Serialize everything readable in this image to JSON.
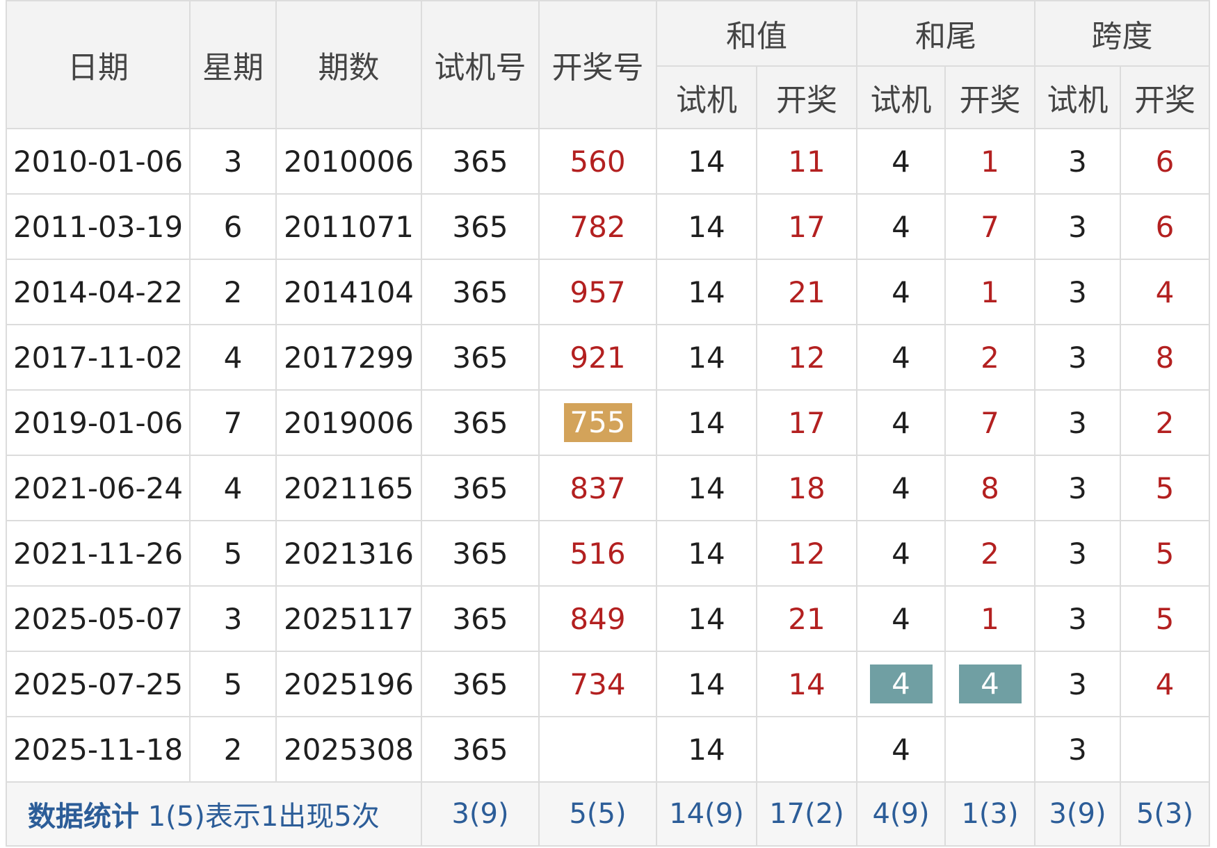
{
  "header": {
    "date": "日期",
    "weekday": "星期",
    "issue": "期数",
    "trial_number": "试机号",
    "draw_number": "开奖号",
    "sum_value": "和值",
    "sum_tail": "和尾",
    "span": "跨度",
    "sub_trial": "试机",
    "sub_draw": "开奖"
  },
  "colors": {
    "draw_text": "#b32020",
    "header_bg": "#f3f3f3",
    "footer_text": "#2c5d98",
    "highlight_gold": "#d3a35a",
    "highlight_teal": "#709fa3"
  },
  "rows": [
    {
      "date": "2010-01-06",
      "weekday": "3",
      "issue": "2010006",
      "trial": "365",
      "draw": "560",
      "sum_trial": "14",
      "sum_draw": "11",
      "tail_trial": "4",
      "tail_draw": "1",
      "span_trial": "3",
      "span_draw": "6"
    },
    {
      "date": "2011-03-19",
      "weekday": "6",
      "issue": "2011071",
      "trial": "365",
      "draw": "782",
      "sum_trial": "14",
      "sum_draw": "17",
      "tail_trial": "4",
      "tail_draw": "7",
      "span_trial": "3",
      "span_draw": "6"
    },
    {
      "date": "2014-04-22",
      "weekday": "2",
      "issue": "2014104",
      "trial": "365",
      "draw": "957",
      "sum_trial": "14",
      "sum_draw": "21",
      "tail_trial": "4",
      "tail_draw": "1",
      "span_trial": "3",
      "span_draw": "4"
    },
    {
      "date": "2017-11-02",
      "weekday": "4",
      "issue": "2017299",
      "trial": "365",
      "draw": "921",
      "sum_trial": "14",
      "sum_draw": "12",
      "tail_trial": "4",
      "tail_draw": "2",
      "span_trial": "3",
      "span_draw": "8"
    },
    {
      "date": "2019-01-06",
      "weekday": "7",
      "issue": "2019006",
      "trial": "365",
      "draw": "755",
      "sum_trial": "14",
      "sum_draw": "17",
      "tail_trial": "4",
      "tail_draw": "7",
      "span_trial": "3",
      "span_draw": "2"
    },
    {
      "date": "2021-06-24",
      "weekday": "4",
      "issue": "2021165",
      "trial": "365",
      "draw": "837",
      "sum_trial": "14",
      "sum_draw": "18",
      "tail_trial": "4",
      "tail_draw": "8",
      "span_trial": "3",
      "span_draw": "5"
    },
    {
      "date": "2021-11-26",
      "weekday": "5",
      "issue": "2021316",
      "trial": "365",
      "draw": "516",
      "sum_trial": "14",
      "sum_draw": "12",
      "tail_trial": "4",
      "tail_draw": "2",
      "span_trial": "3",
      "span_draw": "5"
    },
    {
      "date": "2025-05-07",
      "weekday": "3",
      "issue": "2025117",
      "trial": "365",
      "draw": "849",
      "sum_trial": "14",
      "sum_draw": "21",
      "tail_trial": "4",
      "tail_draw": "1",
      "span_trial": "3",
      "span_draw": "5"
    },
    {
      "date": "2025-07-25",
      "weekday": "5",
      "issue": "2025196",
      "trial": "365",
      "draw": "734",
      "sum_trial": "14",
      "sum_draw": "14",
      "tail_trial": "4",
      "tail_draw": "4",
      "span_trial": "3",
      "span_draw": "4"
    },
    {
      "date": "2025-11-18",
      "weekday": "2",
      "issue": "2025308",
      "trial": "365",
      "draw": "",
      "sum_trial": "14",
      "sum_draw": "",
      "tail_trial": "4",
      "tail_draw": "",
      "span_trial": "3",
      "span_draw": ""
    }
  ],
  "footer": {
    "label": "数据统计",
    "legend": "1(5)表示1出现5次",
    "trial": "3(9)",
    "draw": "5(5)",
    "sum_trial": "14(9)",
    "sum_draw": "17(2)",
    "tail_trial": "4(9)",
    "tail_draw": "1(3)",
    "span_trial": "3(9)",
    "span_draw": "5(3)"
  }
}
